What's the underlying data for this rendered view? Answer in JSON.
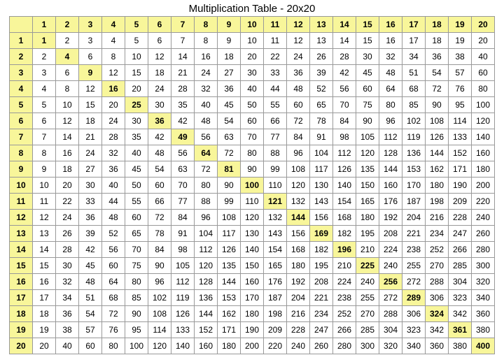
{
  "title": "Multiplication Table - 20x20",
  "chart_data": {
    "type": "table",
    "title": "Multiplication Table - 20x20",
    "size": 20,
    "row_headers": [
      1,
      2,
      3,
      4,
      5,
      6,
      7,
      8,
      9,
      10,
      11,
      12,
      13,
      14,
      15,
      16,
      17,
      18,
      19,
      20
    ],
    "col_headers": [
      1,
      2,
      3,
      4,
      5,
      6,
      7,
      8,
      9,
      10,
      11,
      12,
      13,
      14,
      15,
      16,
      17,
      18,
      19,
      20
    ],
    "values": [
      [
        1,
        2,
        3,
        4,
        5,
        6,
        7,
        8,
        9,
        10,
        11,
        12,
        13,
        14,
        15,
        16,
        17,
        18,
        19,
        20
      ],
      [
        2,
        4,
        6,
        8,
        10,
        12,
        14,
        16,
        18,
        20,
        22,
        24,
        26,
        28,
        30,
        32,
        34,
        36,
        38,
        40
      ],
      [
        3,
        6,
        9,
        12,
        15,
        18,
        21,
        24,
        27,
        30,
        33,
        36,
        39,
        42,
        45,
        48,
        51,
        54,
        57,
        60
      ],
      [
        4,
        8,
        12,
        16,
        20,
        24,
        28,
        32,
        36,
        40,
        44,
        48,
        52,
        56,
        60,
        64,
        68,
        72,
        76,
        80
      ],
      [
        5,
        10,
        15,
        20,
        25,
        30,
        35,
        40,
        45,
        50,
        55,
        60,
        65,
        70,
        75,
        80,
        85,
        90,
        95,
        100
      ],
      [
        6,
        12,
        18,
        24,
        30,
        36,
        42,
        48,
        54,
        60,
        66,
        72,
        78,
        84,
        90,
        96,
        102,
        108,
        114,
        120
      ],
      [
        7,
        14,
        21,
        28,
        35,
        42,
        49,
        56,
        63,
        70,
        77,
        84,
        91,
        98,
        105,
        112,
        119,
        126,
        133,
        140
      ],
      [
        8,
        16,
        24,
        32,
        40,
        48,
        56,
        64,
        72,
        80,
        88,
        96,
        104,
        112,
        120,
        128,
        136,
        144,
        152,
        160
      ],
      [
        9,
        18,
        27,
        36,
        45,
        54,
        63,
        72,
        81,
        90,
        99,
        108,
        117,
        126,
        135,
        144,
        153,
        162,
        171,
        180
      ],
      [
        10,
        20,
        30,
        40,
        50,
        60,
        70,
        80,
        90,
        100,
        110,
        120,
        130,
        140,
        150,
        160,
        170,
        180,
        190,
        200
      ],
      [
        11,
        22,
        33,
        44,
        55,
        66,
        77,
        88,
        99,
        110,
        121,
        132,
        143,
        154,
        165,
        176,
        187,
        198,
        209,
        220
      ],
      [
        12,
        24,
        36,
        48,
        60,
        72,
        84,
        96,
        108,
        120,
        132,
        144,
        156,
        168,
        180,
        192,
        204,
        216,
        228,
        240
      ],
      [
        13,
        26,
        39,
        52,
        65,
        78,
        91,
        104,
        117,
        130,
        143,
        156,
        169,
        182,
        195,
        208,
        221,
        234,
        247,
        260
      ],
      [
        14,
        28,
        42,
        56,
        70,
        84,
        98,
        112,
        126,
        140,
        154,
        168,
        182,
        196,
        210,
        224,
        238,
        252,
        266,
        280
      ],
      [
        15,
        30,
        45,
        60,
        75,
        90,
        105,
        120,
        135,
        150,
        165,
        180,
        195,
        210,
        225,
        240,
        255,
        270,
        285,
        300
      ],
      [
        16,
        32,
        48,
        64,
        80,
        96,
        112,
        128,
        144,
        160,
        176,
        192,
        208,
        224,
        240,
        256,
        272,
        288,
        304,
        320
      ],
      [
        17,
        34,
        51,
        68,
        85,
        102,
        119,
        136,
        153,
        170,
        187,
        204,
        221,
        238,
        255,
        272,
        289,
        306,
        323,
        340
      ],
      [
        18,
        36,
        54,
        72,
        90,
        108,
        126,
        144,
        162,
        180,
        198,
        216,
        234,
        252,
        270,
        288,
        306,
        324,
        342,
        360
      ],
      [
        19,
        38,
        57,
        76,
        95,
        114,
        133,
        152,
        171,
        190,
        209,
        228,
        247,
        266,
        285,
        304,
        323,
        342,
        361,
        380
      ],
      [
        20,
        40,
        60,
        80,
        100,
        120,
        140,
        160,
        180,
        200,
        220,
        240,
        260,
        280,
        300,
        320,
        340,
        360,
        380,
        400
      ]
    ]
  }
}
